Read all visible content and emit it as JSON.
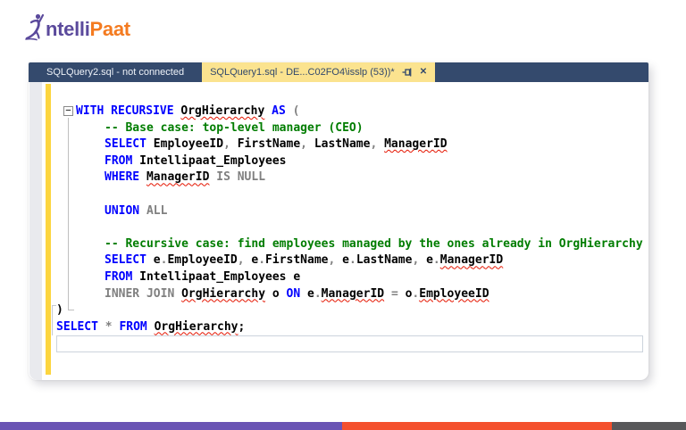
{
  "logo": {
    "text_primary": "ntelli",
    "text_secondary": "Paat"
  },
  "colors": {
    "keyword": "#0000ff",
    "comment": "#007d00",
    "operator": "#808080",
    "identifier": "#000000",
    "error_underline": "#e51400",
    "tab_bar": "#344a6d",
    "tab_active_bg": "#fbe38f",
    "tab_active_text": "#31486c",
    "tab_inactive_text": "#eef2f8",
    "change_bar": "#fcd53f",
    "logo_purple": "#5b4a9c",
    "logo_orange": "#f47b20"
  },
  "editor": {
    "tabs": [
      {
        "name": "tab-sqlquery2",
        "label": "SQLQuery2.sql - not connected",
        "active": false
      },
      {
        "name": "tab-sqlquery1",
        "label": "SQLQuery1.sql - DE...C02FO4\\isslp (53))*",
        "active": true
      }
    ],
    "close_glyph": "✕",
    "collapse_glyph": "–",
    "code": {
      "lines": [
        {
          "first": true,
          "indent": 0,
          "segments": [
            {
              "t": "WITH RECURSIVE ",
              "c": "kw"
            },
            {
              "t": "OrgHierarchy",
              "c": "id",
              "e": true
            },
            {
              "t": " ",
              "c": "id"
            },
            {
              "t": "AS",
              "c": "kw"
            },
            {
              "t": " ",
              "c": "id"
            },
            {
              "t": "(",
              "c": "gr"
            }
          ]
        },
        {
          "indent": 1,
          "segments": [
            {
              "t": "-- Base case: top-level manager (CEO)",
              "c": "cm"
            }
          ]
        },
        {
          "indent": 1,
          "segments": [
            {
              "t": "SELECT",
              "c": "kw"
            },
            {
              "t": " EmployeeID",
              "c": "id"
            },
            {
              "t": ",",
              "c": "gr"
            },
            {
              "t": " FirstName",
              "c": "id"
            },
            {
              "t": ",",
              "c": "gr"
            },
            {
              "t": " LastName",
              "c": "id"
            },
            {
              "t": ",",
              "c": "gr"
            },
            {
              "t": " ",
              "c": "id"
            },
            {
              "t": "ManagerID",
              "c": "id",
              "e": true
            }
          ]
        },
        {
          "indent": 1,
          "segments": [
            {
              "t": "FROM",
              "c": "kw"
            },
            {
              "t": " Intellipaat_Employees",
              "c": "id"
            }
          ]
        },
        {
          "indent": 1,
          "segments": [
            {
              "t": "WHERE",
              "c": "kw"
            },
            {
              "t": " ",
              "c": "id"
            },
            {
              "t": "ManagerID",
              "c": "id",
              "e": true
            },
            {
              "t": " ",
              "c": "id"
            },
            {
              "t": "IS NULL",
              "c": "gr"
            }
          ]
        },
        {
          "indent": 1,
          "segments": []
        },
        {
          "indent": 1,
          "segments": [
            {
              "t": "UNION",
              "c": "kw"
            },
            {
              "t": " ",
              "c": "id"
            },
            {
              "t": "ALL",
              "c": "gr"
            }
          ]
        },
        {
          "indent": 1,
          "segments": []
        },
        {
          "indent": 1,
          "segments": [
            {
              "t": "-- Recursive case: find employees managed by the ones already in OrgHierarchy",
              "c": "cm"
            }
          ]
        },
        {
          "indent": 1,
          "segments": [
            {
              "t": "SELECT",
              "c": "kw"
            },
            {
              "t": " e",
              "c": "id"
            },
            {
              "t": ".",
              "c": "gr"
            },
            {
              "t": "EmployeeID",
              "c": "id"
            },
            {
              "t": ",",
              "c": "gr"
            },
            {
              "t": " e",
              "c": "id"
            },
            {
              "t": ".",
              "c": "gr"
            },
            {
              "t": "FirstName",
              "c": "id"
            },
            {
              "t": ",",
              "c": "gr"
            },
            {
              "t": " e",
              "c": "id"
            },
            {
              "t": ".",
              "c": "gr"
            },
            {
              "t": "LastName",
              "c": "id"
            },
            {
              "t": ",",
              "c": "gr"
            },
            {
              "t": " e",
              "c": "id"
            },
            {
              "t": ".",
              "c": "gr"
            },
            {
              "t": "ManagerID",
              "c": "id",
              "e": true
            }
          ]
        },
        {
          "indent": 1,
          "segments": [
            {
              "t": "FROM",
              "c": "kw"
            },
            {
              "t": " Intellipaat_Employees e",
              "c": "id"
            }
          ]
        },
        {
          "indent": 1,
          "segments": [
            {
              "t": "INNER JOIN",
              "c": "gr"
            },
            {
              "t": " ",
              "c": "id"
            },
            {
              "t": "OrgHierarchy",
              "c": "id",
              "e": true
            },
            {
              "t": " o ",
              "c": "id"
            },
            {
              "t": "ON",
              "c": "kw"
            },
            {
              "t": " e",
              "c": "id"
            },
            {
              "t": ".",
              "c": "gr"
            },
            {
              "t": "ManagerID",
              "c": "id",
              "e": true
            },
            {
              "t": " ",
              "c": "id"
            },
            {
              "t": "=",
              "c": "gr"
            },
            {
              "t": " o",
              "c": "id"
            },
            {
              "t": ".",
              "c": "gr"
            },
            {
              "t": "EmployeeID",
              "c": "id",
              "e": true
            }
          ]
        },
        {
          "indent": 0,
          "segments": [
            {
              "t": ")",
              "c": "id"
            }
          ]
        },
        {
          "indent": 0,
          "segments": [
            {
              "t": "SELECT",
              "c": "kw"
            },
            {
              "t": " ",
              "c": "id"
            },
            {
              "t": "*",
              "c": "gr"
            },
            {
              "t": " ",
              "c": "id"
            },
            {
              "t": "FROM",
              "c": "kw"
            },
            {
              "t": " ",
              "c": "id"
            },
            {
              "t": "OrgHierarchy",
              "c": "id",
              "e": true
            },
            {
              "t": ";",
              "c": "id"
            }
          ]
        },
        {
          "indent": 0,
          "current": true,
          "segments": []
        }
      ]
    }
  },
  "footer": {
    "segments": [
      {
        "name": "footer-purple-segment",
        "color": "#6a54b4",
        "width_pct": 49.9
      },
      {
        "name": "footer-orange-segment",
        "color": "#f4502d",
        "width_pct": 39.3
      },
      {
        "name": "footer-gray-segment",
        "color": "#58585a",
        "width_pct": 10.8
      }
    ]
  }
}
